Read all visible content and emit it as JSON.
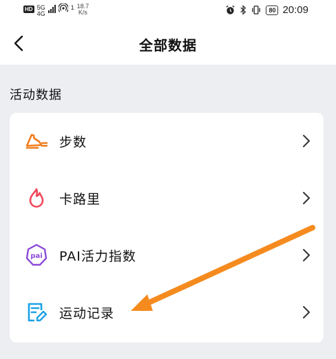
{
  "status_bar": {
    "hd": "HD",
    "network": "5G",
    "network_sub": "4G",
    "hotspot_count": "1",
    "speed_value": "18.7",
    "speed_unit": "K/s",
    "battery": "80",
    "time": "20:09"
  },
  "header": {
    "title": "全部数据"
  },
  "section": {
    "title": "活动数据",
    "items": [
      {
        "label": "步数",
        "icon": "shoe-icon",
        "color": "#f07c1c"
      },
      {
        "label": "卡路里",
        "icon": "flame-icon",
        "color": "#f0485a"
      },
      {
        "label": "PAI活力指数",
        "icon": "pai-icon",
        "color": "#8b49d9"
      },
      {
        "label": "运动记录",
        "icon": "note-icon",
        "color": "#1aa1e8"
      }
    ]
  },
  "annotation": {
    "arrow_color": "#f58b1f"
  }
}
